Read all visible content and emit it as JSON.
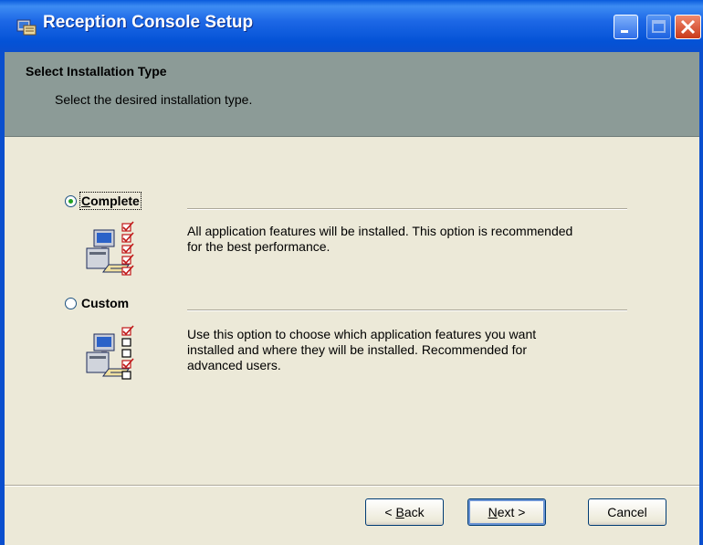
{
  "window": {
    "title": "Reception Console Setup",
    "buttons": [
      "minimize",
      "maximize",
      "close"
    ]
  },
  "header": {
    "title": "Select Installation Type",
    "subtitle": "Select the desired installation type."
  },
  "options": [
    {
      "label": "Complete",
      "selected": true,
      "description_line1": "All application features will be installed. This option is recommended",
      "description_line2": "for the best performance.",
      "icon": "computer-checklist-all-checked-icon"
    },
    {
      "label": "Custom",
      "selected": false,
      "description_line1": "Use this option to choose which application features you want",
      "description_line2": "installed and where they will be installed. Recommended for",
      "description_line3": "advanced users.",
      "icon": "computer-checklist-partial-icon"
    }
  ],
  "footer": {
    "back_pre": "< ",
    "back_key": "B",
    "back_post": "ack",
    "next_key": "N",
    "next_post": "ext >",
    "cancel": "Cancel"
  },
  "colors": {
    "titlebar": "#0452d6",
    "header": "#8c9b97",
    "body": "#ece9d8",
    "radio_dot": "#21a121"
  }
}
